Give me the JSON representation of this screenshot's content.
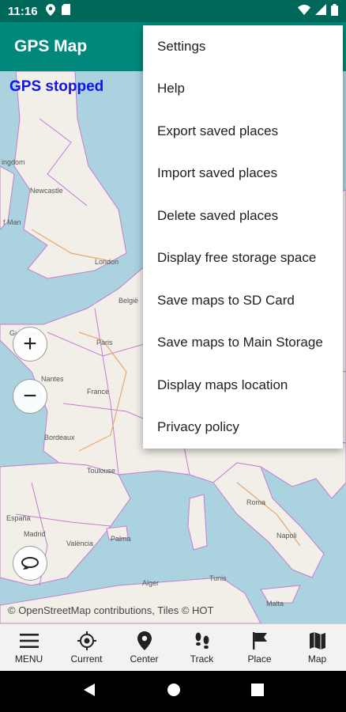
{
  "status_bar": {
    "time": "11:16",
    "icons": [
      "location-icon",
      "sd-card-icon",
      "wifi-icon",
      "signal-icon",
      "battery-icon"
    ]
  },
  "app_bar": {
    "title": "GPS Map"
  },
  "map": {
    "gps_status": "GPS stopped",
    "zoom_in_label": "+",
    "zoom_out_label": "−",
    "attribution": "© OpenStreetMap contributions, Tiles © HOT",
    "place_labels": {
      "kingdom": "ingdom",
      "newcastle": "Newcastle",
      "isle_of_man": "f Man",
      "london": "London",
      "paris": "Paris",
      "france": "France",
      "nantes": "Nantes",
      "bordeaux": "Bordeaux",
      "toulouse": "Toulouse",
      "espana": "España",
      "madrid": "Madrid",
      "palma": "Palma",
      "valencia": "València",
      "belgie": "België",
      "roma": "Roma",
      "napoli": "Napoli",
      "malta": "Malta",
      "tunis": "Tunis",
      "alger": "Alger",
      "guernsey": "Guernsey"
    },
    "colors": {
      "water": "#aad3df",
      "land": "#f2efe9",
      "border": "#c77ad6"
    }
  },
  "popup_menu": {
    "items": [
      "Settings",
      "Help",
      "Export saved places",
      "Import saved places",
      "Delete saved places",
      "Display free storage space",
      "Save maps to SD Card",
      "Save maps to Main Storage",
      "Display maps location",
      "Privacy policy"
    ]
  },
  "bottom_nav": {
    "items": [
      {
        "label": "MENU",
        "icon": "hamburger-icon"
      },
      {
        "label": "Current",
        "icon": "crosshair-icon"
      },
      {
        "label": "Center",
        "icon": "pin-icon"
      },
      {
        "label": "Track",
        "icon": "footsteps-icon"
      },
      {
        "label": "Place",
        "icon": "flag-icon"
      },
      {
        "label": "Map",
        "icon": "map-icon"
      }
    ]
  },
  "colors": {
    "app_bar": "#00897b",
    "status_bar": "#00685a",
    "gps_status": "#1212ee"
  }
}
